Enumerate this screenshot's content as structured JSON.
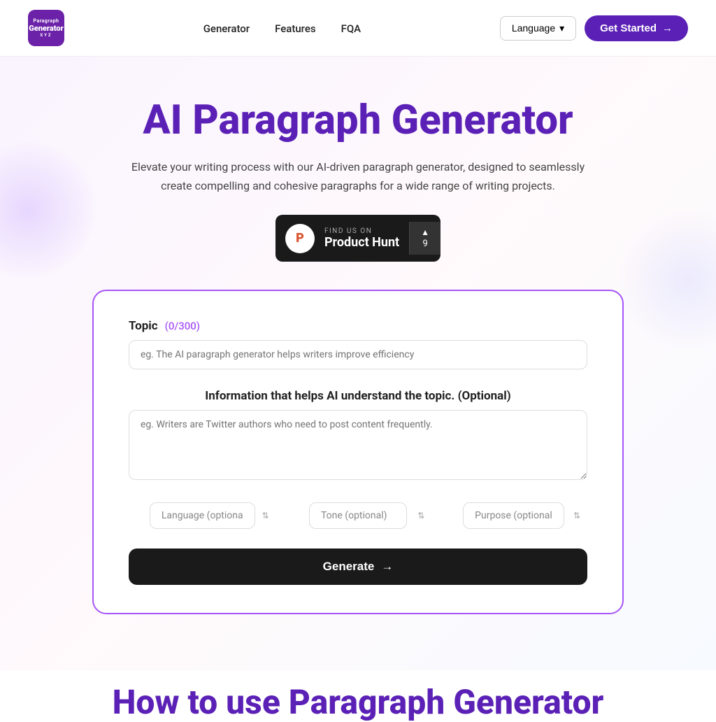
{
  "nav": {
    "logo_line1": "Paragraph",
    "logo_line2": "Generator",
    "logo_line3": "XYZ",
    "links": [
      {
        "label": "Generator",
        "href": "#"
      },
      {
        "label": "Features",
        "href": "#"
      },
      {
        "label": "FQA",
        "href": "#"
      }
    ],
    "language_label": "Language",
    "get_started_label": "Get Started"
  },
  "hero": {
    "title": "AI Paragraph Generator",
    "subtitle": "Elevate your writing process with our AI-driven paragraph generator, designed to seamlessly create compelling and cohesive paragraphs for a wide range of writing projects.",
    "ph_badge": {
      "find_us": "FIND US ON",
      "name": "Product Hunt",
      "logo_letter": "P",
      "upvote_arrow": "▲",
      "upvote_count": "9"
    }
  },
  "form": {
    "topic_label": "Topic",
    "char_count": "(0/300)",
    "topic_placeholder": "eg. The AI paragraph generator helps writers improve efficiency",
    "info_label": "Information that helps AI understand the topic. (Optional)",
    "info_placeholder": "eg. Writers are Twitter authors who need to post content frequently.",
    "language_placeholder": "Language (optiona",
    "tone_placeholder": "Tone (optional)",
    "purpose_placeholder": "Purpose (optional",
    "generate_label": "Generate",
    "generate_arrow": "→"
  },
  "how_to": {
    "title": "How to use Paragraph Generator"
  }
}
